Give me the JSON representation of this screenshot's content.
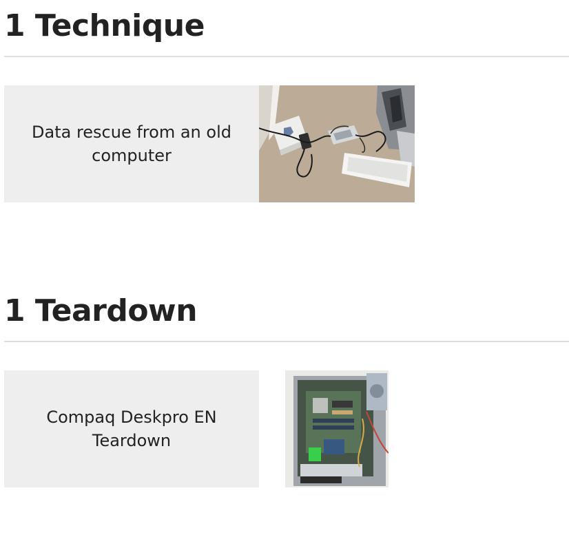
{
  "sections": [
    {
      "title": "1 Technique",
      "items": [
        {
          "label": "Data rescue from an old computer"
        }
      ]
    },
    {
      "title": "1 Teardown",
      "items": [
        {
          "label": "Compaq Deskpro EN Teardown"
        }
      ]
    }
  ]
}
